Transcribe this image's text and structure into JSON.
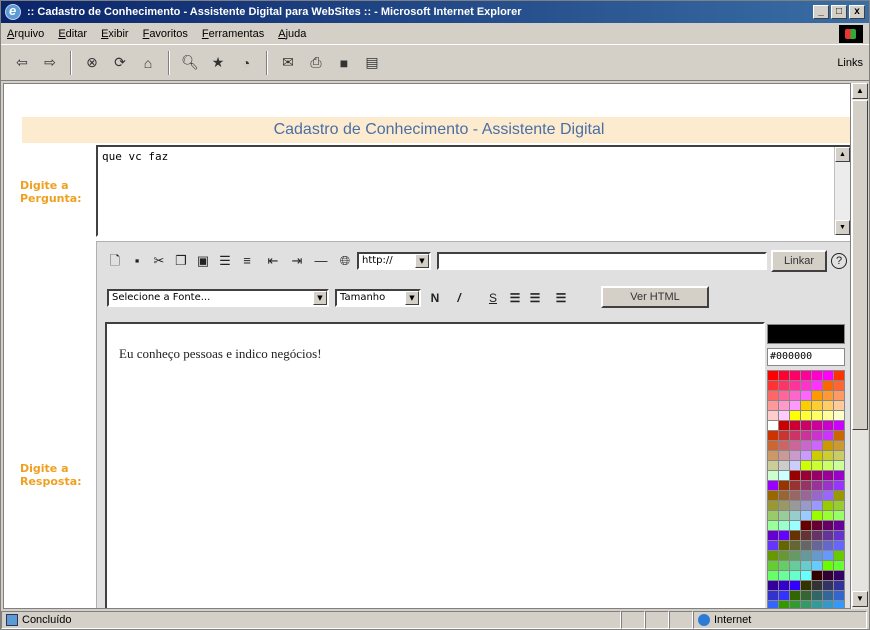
{
  "window": {
    "title": ":: Cadastro de Conhecimento - Assistente Digital para WebSites :: - Microsoft Internet Explorer",
    "caption_buttons": [
      "_",
      "□",
      "x"
    ]
  },
  "menu": {
    "items": [
      "Arquivo",
      "Editar",
      "Exibir",
      "Favoritos",
      "Ferramentas",
      "Ajuda"
    ],
    "links_label": "Links"
  },
  "toolbar": {
    "icons": [
      "back-icon",
      "forward-icon",
      "stop-icon",
      "refresh-icon",
      "home-icon",
      "search-icon",
      "favorites-icon",
      "history-icon",
      "mail-icon",
      "print-icon",
      "edit-icon",
      "discuss-icon"
    ]
  },
  "form": {
    "title": "Cadastro de Conhecimento - Assistente Digital",
    "question_label": "Digite a Pergunta:",
    "question_value": "que vc faz",
    "answer_label": "Digite a Resposta:",
    "answer_value": "Eu conheço pessoas e indico negócios!"
  },
  "editor": {
    "url_select": "http://",
    "url_input": "",
    "link_button": "Linkar",
    "help_icon": "?",
    "font_select": "Selecione a Fonte...",
    "size_select": "Tamanho",
    "bold": "N",
    "italic": "/",
    "underline": "S",
    "view_html_button": "Ver HTML",
    "current_color": "#000000",
    "current_color_hex": "#000000"
  },
  "status": {
    "text": "Concluído",
    "zone": "Internet"
  }
}
